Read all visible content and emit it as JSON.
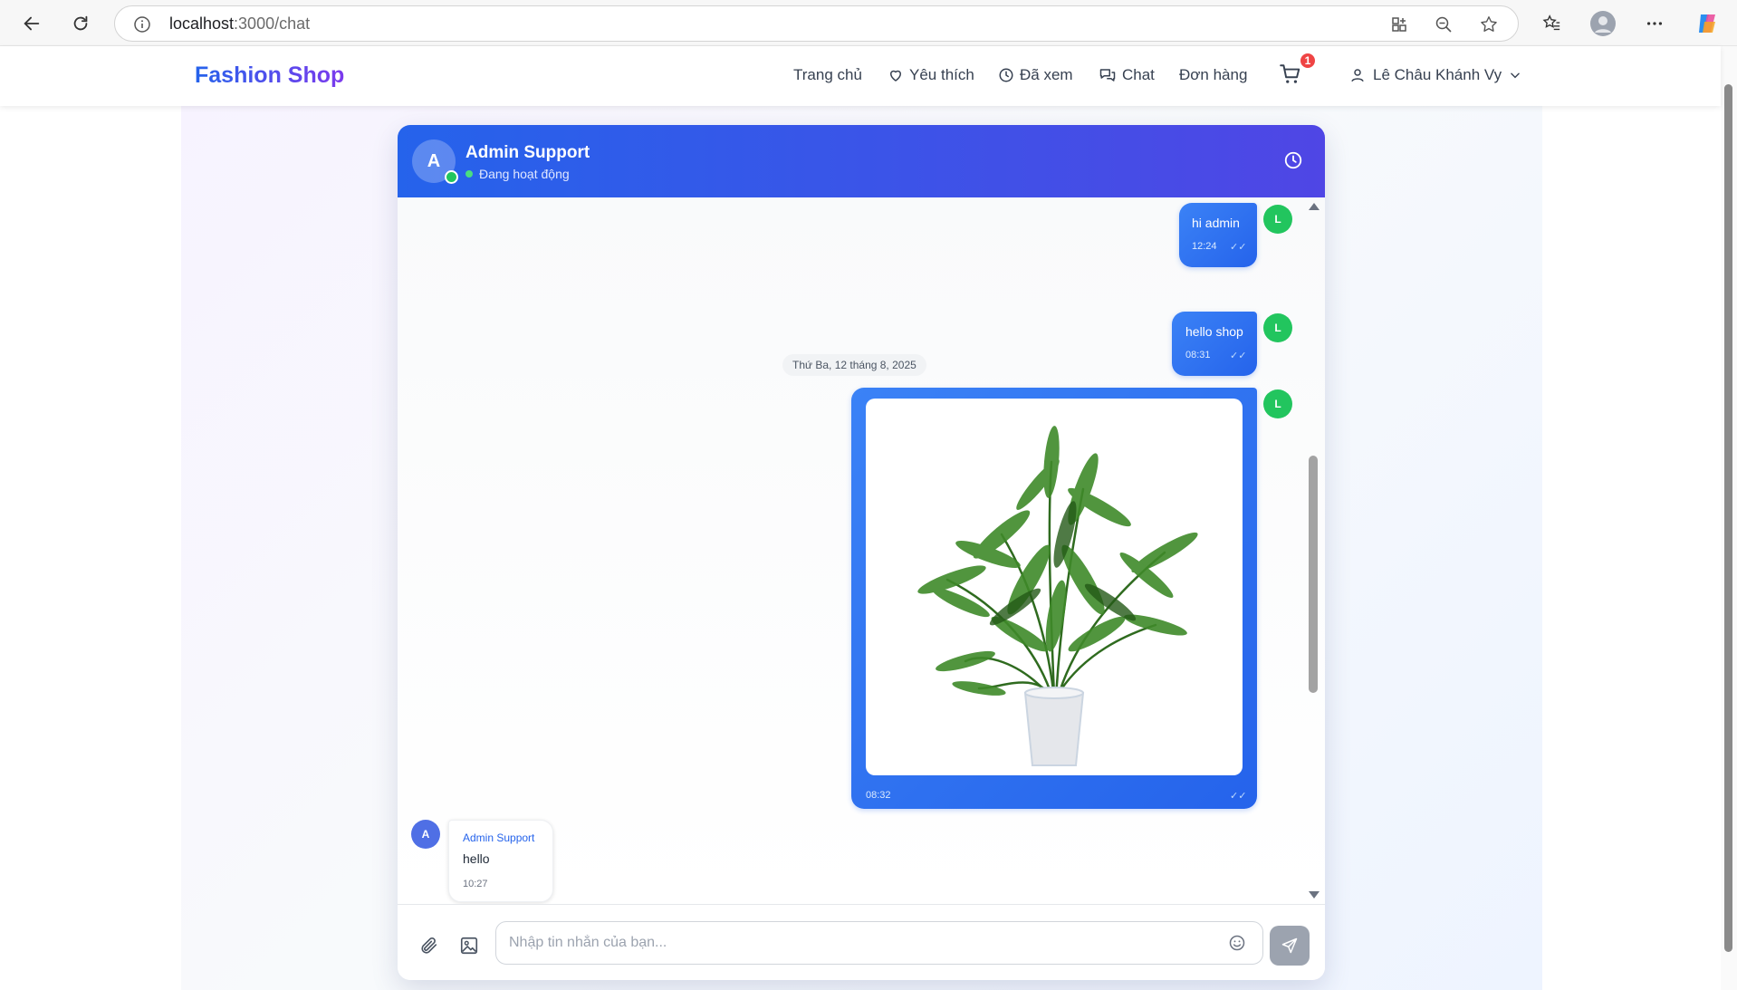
{
  "browser": {
    "url_host": "localhost",
    "url_path": ":3000/chat"
  },
  "header": {
    "brand": "Fashion Shop",
    "nav": {
      "home": "Trang chủ",
      "favorites": "Yêu thích",
      "viewed": "Đã xem",
      "chat": "Chat",
      "orders": "Đơn hàng"
    },
    "cart_count": "1",
    "user_name": "Lê Châu Khánh Vy"
  },
  "chat": {
    "contact_initial": "A",
    "contact_name": "Admin Support",
    "contact_status": "Đang hoạt động",
    "user_initial": "L",
    "date_divider": "Thứ Ba, 12 tháng 8, 2025",
    "messages": [
      {
        "text": "hi admin",
        "time": "12:24",
        "read_mark": "✓✓"
      },
      {
        "text": "hello shop",
        "time": "08:31",
        "read_mark": "✓✓"
      },
      {
        "image": "potted-palm-plant",
        "time": "08:32",
        "read_mark": "✓✓"
      }
    ],
    "incoming": {
      "initial": "A",
      "sender": "Admin Support",
      "text": "hello",
      "time": "10:27"
    },
    "composer_placeholder": "Nhập tin nhắn của bạn..."
  },
  "colors": {
    "brand_start": "#2563eb",
    "brand_end": "#7c3aed",
    "header_gradient_start": "#2563eb",
    "header_gradient_end": "#4f46e5",
    "online": "#22c55e",
    "badge": "#ef4444"
  }
}
